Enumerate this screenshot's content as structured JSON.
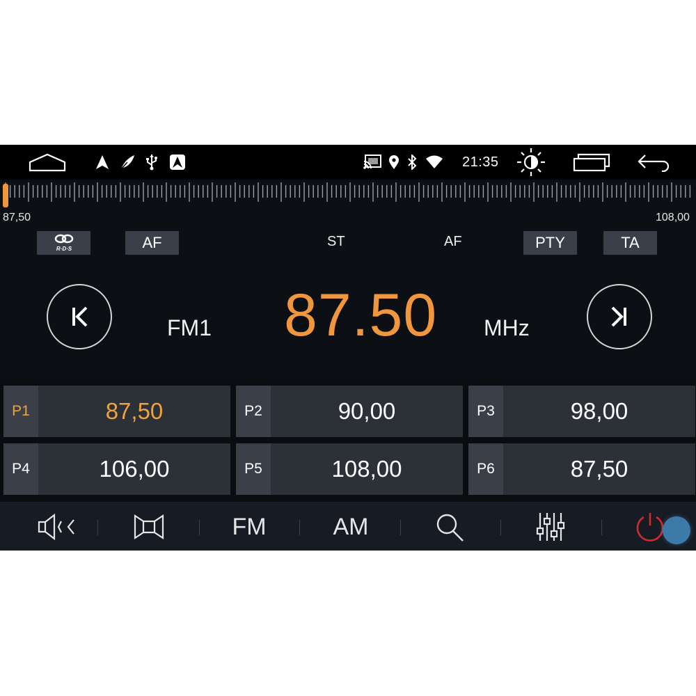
{
  "status_bar": {
    "time": "21:35",
    "icons": [
      "home-icon",
      "navigation-arrow-icon",
      "feather-icon",
      "usb-icon",
      "android-auto-icon",
      "cast-icon",
      "location-icon",
      "bluetooth-icon",
      "wifi-icon",
      "brightness-icon",
      "recent-apps-icon",
      "back-icon"
    ]
  },
  "scale": {
    "min_label": "87,50",
    "max_label": "108,00",
    "min": 87.5,
    "max": 108.0,
    "current": 87.5
  },
  "indicators": {
    "rds": "R·D·S",
    "af_button": "AF",
    "st": "ST",
    "af_status": "AF",
    "pty": "PTY",
    "ta": "TA"
  },
  "tuner": {
    "band": "FM1",
    "frequency": "87.50",
    "unit": "MHz"
  },
  "presets": [
    {
      "label": "P1",
      "freq": "87,50",
      "active": true
    },
    {
      "label": "P2",
      "freq": "90,00",
      "active": false
    },
    {
      "label": "P3",
      "freq": "98,00",
      "active": false
    },
    {
      "label": "P4",
      "freq": "106,00",
      "active": false
    },
    {
      "label": "P5",
      "freq": "108,00",
      "active": false
    },
    {
      "label": "P6",
      "freq": "87,50",
      "active": false
    }
  ],
  "toolbar": {
    "fm_label": "FM",
    "am_label": "AM",
    "icons": [
      "mute-speaker-icon",
      "stereo-speaker-icon",
      "search-icon",
      "equalizer-icon",
      "power-icon"
    ]
  },
  "colors": {
    "accent": "#f0963c",
    "power": "#d42a2a",
    "background": "#0c0f13"
  }
}
